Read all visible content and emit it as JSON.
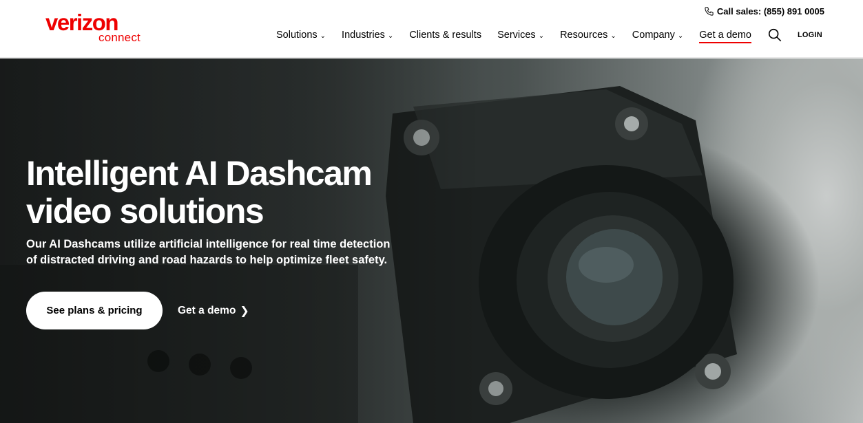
{
  "brand": {
    "name": "verizon",
    "product": "connect",
    "accent": "#ee0000"
  },
  "header": {
    "call_sales": "Call sales: (855) 891 0005",
    "phone_icon": "phone-icon",
    "nav": [
      {
        "label": "Solutions",
        "dropdown": true
      },
      {
        "label": "Industries",
        "dropdown": true
      },
      {
        "label": "Clients & results",
        "dropdown": false
      },
      {
        "label": "Services",
        "dropdown": true
      },
      {
        "label": "Resources",
        "dropdown": true
      },
      {
        "label": "Company",
        "dropdown": true
      }
    ],
    "demo_link": "Get a demo",
    "search_icon": "search-icon",
    "login": "LOGIN"
  },
  "hero": {
    "title_line1": "Intelligent AI Dashcam",
    "title_line2": "video solutions",
    "subtitle_line1": "Our AI Dashcams utilize artificial intelligence for real time detection",
    "subtitle_line2": "of distracted driving and road hazards to help optimize fleet safety.",
    "primary_button": "See plans & pricing",
    "secondary_link": "Get a demo",
    "secondary_icon": "chevron-right-icon"
  }
}
